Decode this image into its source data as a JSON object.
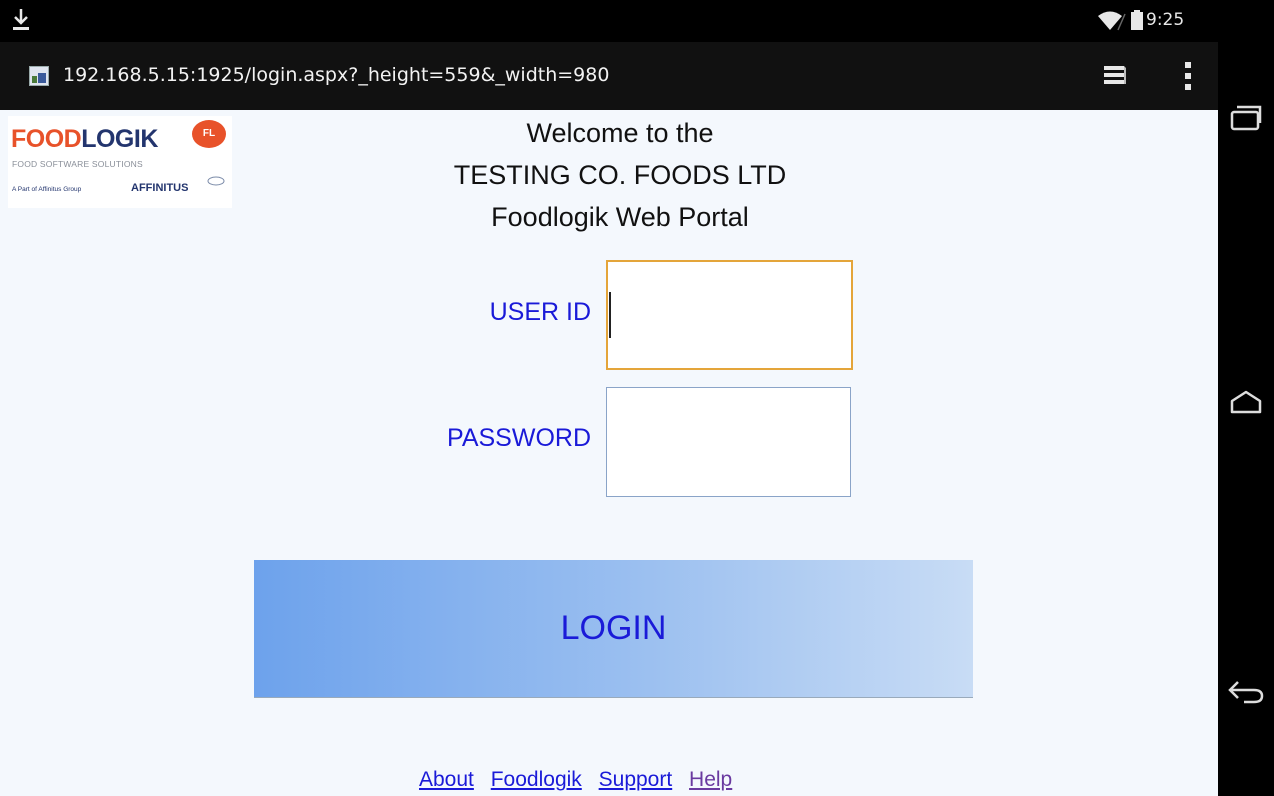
{
  "status_bar": {
    "time": "9:25",
    "icons": [
      "download-icon",
      "wifi-icon",
      "battery-icon"
    ]
  },
  "browser": {
    "url": "192.168.5.15:1925/login.aspx?_height=559&_width=980",
    "icons": [
      "favicon",
      "tabs-icon",
      "overflow-menu-icon"
    ]
  },
  "nav_bar": {
    "icons": [
      "recent-apps-icon",
      "home-icon",
      "back-icon"
    ]
  },
  "logo": {
    "brand_part1": "FOOD",
    "brand_part2": "LOGIK",
    "badge": "FL",
    "tagline": "FOOD SOFTWARE SOLUTIONS",
    "part_of": "A Part of Affinitus Group",
    "group_name": "AFFINITUS"
  },
  "welcome": {
    "line1": "Welcome to the",
    "line2": "TESTING CO. FOODS LTD",
    "line3": "Foodlogik Web Portal"
  },
  "form": {
    "user_id_label": "USER ID",
    "user_id_value": "",
    "password_label": "PASSWORD",
    "password_value": "",
    "login_label": "LOGIN"
  },
  "footer": {
    "links": [
      "About",
      "Foodlogik",
      "Support",
      "Help"
    ]
  },
  "colors": {
    "label_blue": "#1a1ad8",
    "focus_border": "#e4a53a",
    "brand_orange": "#e8522a",
    "brand_navy": "#23356e"
  }
}
